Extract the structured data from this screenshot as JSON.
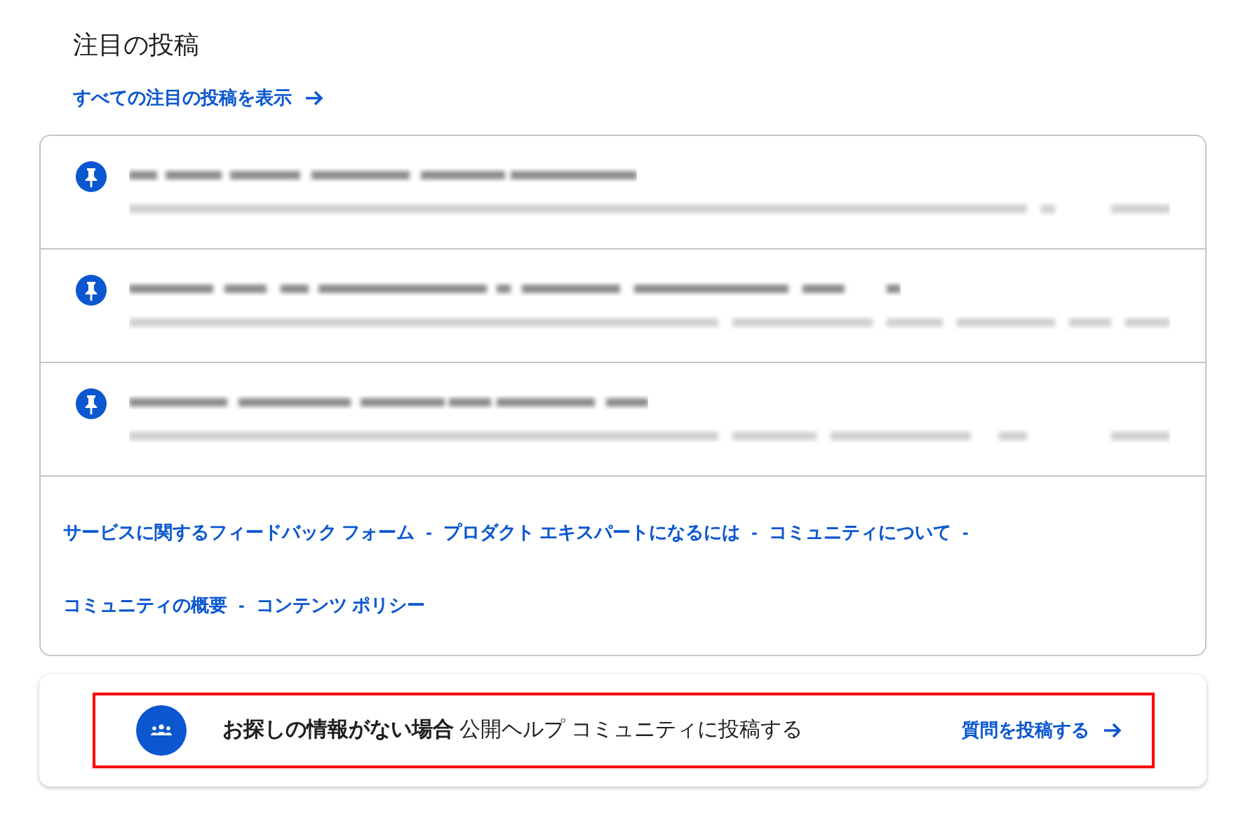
{
  "heading": "注目の投稿",
  "view_all_link": "すべての注目の投稿を表示",
  "posts": [
    {
      "pinned": true
    },
    {
      "pinned": true
    },
    {
      "pinned": true
    }
  ],
  "footer_links": [
    [
      {
        "label": "サービスに関するフィードバック フォーム",
        "separator": "-"
      },
      {
        "label": "プロダクト エキスパートになるには",
        "separator": "-"
      },
      {
        "label": "コミュニティについて",
        "separator": "-"
      }
    ],
    [
      {
        "label": "コミュニティの概要",
        "separator": "-"
      },
      {
        "label": "コンテンツ ポリシー"
      }
    ]
  ],
  "banner": {
    "highlighted": true,
    "text": "**お探しの情報がない場合** 公開ヘルプ コミュニティに投稿する",
    "action": "質問を投稿する"
  }
}
